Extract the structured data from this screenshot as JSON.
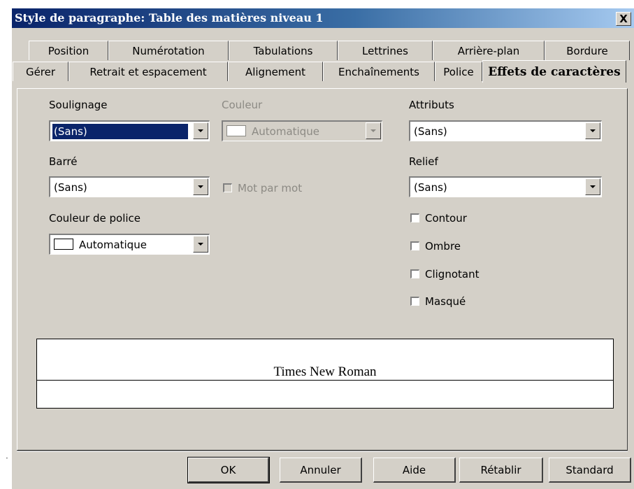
{
  "window": {
    "title": "Style de paragraphe: Table des matières niveau 1",
    "close_label": "X"
  },
  "tabs": {
    "row1": [
      "Position",
      "Numérotation",
      "Tabulations",
      "Lettrines",
      "Arrière-plan",
      "Bordure"
    ],
    "row2": [
      "Gérer",
      "Retrait et espacement",
      "Alignement",
      "Enchaînements",
      "Police",
      "Effets de caractères"
    ],
    "active": "Effets de caractères"
  },
  "panel": {
    "soulignage": {
      "label": "Soulignage",
      "value": "(Sans)"
    },
    "couleur": {
      "label": "Couleur",
      "value": "Automatique",
      "enabled": false
    },
    "attributs": {
      "label": "Attributs",
      "value": "(Sans)"
    },
    "barre": {
      "label": "Barré",
      "value": "(Sans)"
    },
    "mot_par_mot": {
      "label": "Mot par mot",
      "checked": false,
      "enabled": false
    },
    "relief": {
      "label": "Relief",
      "value": "(Sans)"
    },
    "couleur_police": {
      "label": "Couleur de police",
      "value": "Automatique"
    },
    "contour": {
      "label": "Contour",
      "checked": false
    },
    "ombre": {
      "label": "Ombre",
      "checked": false
    },
    "clignotant": {
      "label": "Clignotant",
      "checked": false
    },
    "masque": {
      "label": "Masqué",
      "checked": false
    }
  },
  "preview": {
    "text": "Times New Roman"
  },
  "buttons": {
    "ok": "OK",
    "annuler": "Annuler",
    "aide": "Aide",
    "retablir": "Rétablir",
    "standard": "Standard"
  },
  "colors": {
    "dialog_bg": "#d4d0c8",
    "title_gradient_start": "#0a246a",
    "title_gradient_end": "#a6caf0",
    "selection": "#0a246a"
  }
}
